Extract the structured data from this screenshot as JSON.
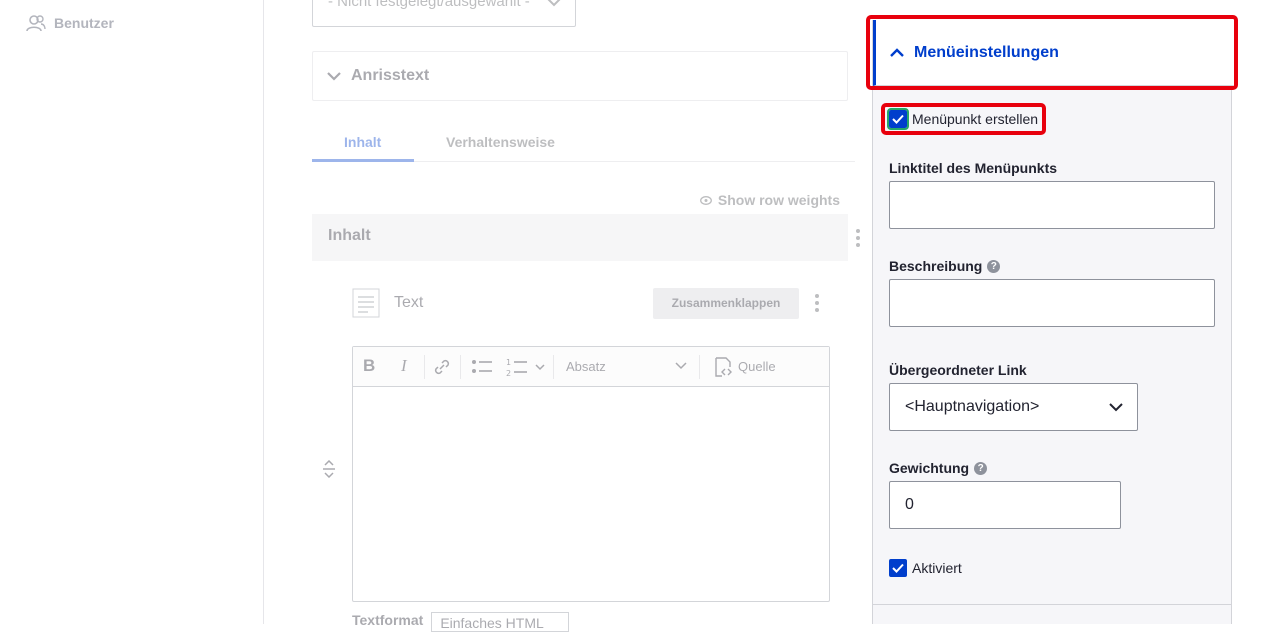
{
  "sidebar": {
    "users_label": "Benutzer"
  },
  "main": {
    "top_select_value": "- Nicht festgelegt/ausgewählt -",
    "teaser_label": "Anrisstext",
    "tabs": [
      {
        "label": "Inhalt"
      },
      {
        "label": "Verhaltensweise"
      }
    ],
    "show_row_weights": "Show row weights",
    "content_section_title": "Inhalt",
    "text_item_label": "Text",
    "collapse_button": "Zusammenklappen",
    "editor": {
      "paragraph_style": "Absatz",
      "source_label": "Quelle"
    },
    "text_format_label": "Textformat",
    "text_format_value": "Einfaches HTML"
  },
  "menu_settings": {
    "title": "Menüeinstellungen",
    "create_menu_item_label": "Menüpunkt erstellen",
    "link_title_label": "Linktitel des Menüpunkts",
    "link_title_value": "",
    "description_label": "Beschreibung",
    "description_value": "",
    "parent_link_label": "Übergeordneter Link",
    "parent_link_value": "<Hauptnavigation>",
    "weight_label": "Gewichtung",
    "weight_value": "0",
    "enabled_label": "Aktiviert",
    "help_glyph": "?"
  },
  "colors": {
    "accent": "#003ecc",
    "highlight": "#e8000d"
  }
}
